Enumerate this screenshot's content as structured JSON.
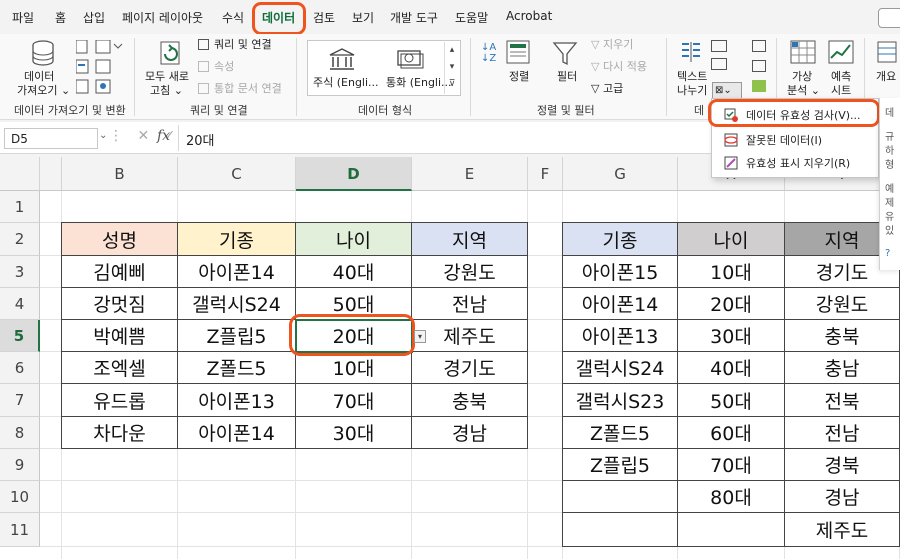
{
  "menu": {
    "tabs": [
      "파일",
      "홈",
      "삽입",
      "페이지 레이아웃",
      "수식",
      "데이터",
      "검토",
      "보기",
      "개발 도구",
      "도움말",
      "Acrobat"
    ],
    "active": "데이터"
  },
  "ribbon": {
    "get_data": {
      "label": "데이터 가져오기",
      "group": "데이터 가져오기 및 변환"
    },
    "queries": {
      "refresh_all": "모두 새로 고침",
      "queries_connections": "쿼리 및 연결",
      "properties": "속성",
      "edit_links": "통합 문서 연결",
      "group": "쿼리 및 연결"
    },
    "data_types": {
      "stocks": "주식 (Engli...",
      "currencies": "통화 (Engli...",
      "group": "데이터 형식"
    },
    "sort_filter": {
      "sort": "정렬",
      "filter": "필터",
      "clear": "지우기",
      "reapply": "다시 적용",
      "advanced": "고급",
      "group": "정렬 및 필터"
    },
    "data_tools": {
      "text_to_columns": "텍스트 나누기",
      "group_prefix": "데"
    },
    "forecast": {
      "what_if": "가상 분석",
      "forecast_sheet": "예측 시트",
      "outline": "개요"
    }
  },
  "dropdown": {
    "items": [
      "데이터 유효성 검사(V)...",
      "잘못된 데이터(I)",
      "유효성 표시 지우기(R)"
    ]
  },
  "side_panel": {
    "chars": [
      "데",
      "규",
      "하",
      "형",
      "예",
      "제",
      "유",
      "있",
      "?"
    ]
  },
  "formula_bar": {
    "name_box": "D5",
    "fx": "fx",
    "value": "20대"
  },
  "columns": [
    "B",
    "C",
    "D",
    "E",
    "F",
    "G",
    "H",
    "I"
  ],
  "rows": [
    "1",
    "2",
    "3",
    "4",
    "5",
    "6",
    "7",
    "8",
    "9",
    "10",
    "11"
  ],
  "selected": {
    "col": "D",
    "row": "5"
  },
  "table1": {
    "headers": [
      "성명",
      "기종",
      "나이",
      "지역"
    ],
    "header_colors": [
      "#fbe2d5",
      "#fff2cc",
      "#e2efda",
      "#d9e1f2"
    ],
    "rows": [
      [
        "김예삐",
        "아이폰14",
        "40대",
        "강원도"
      ],
      [
        "강멋짐",
        "갤럭시S24",
        "50대",
        "전남"
      ],
      [
        "박예쁨",
        "Z플립5",
        "20대",
        "제주도"
      ],
      [
        "조엑셀",
        "Z폴드5",
        "10대",
        "경기도"
      ],
      [
        "유드롭",
        "아이폰13",
        "70대",
        "충북"
      ],
      [
        "차다운",
        "아이폰14",
        "30대",
        "경남"
      ]
    ]
  },
  "table2": {
    "headers": [
      "기종",
      "나이",
      "지역"
    ],
    "header_colors": [
      "#d9e1f2",
      "#d0cece",
      "#a6a6a6"
    ],
    "col1": [
      "아이폰15",
      "아이폰14",
      "아이폰13",
      "갤럭시S24",
      "갤럭시S23",
      "Z폴드5",
      "Z플립5",
      "",
      ""
    ],
    "col2": [
      "10대",
      "20대",
      "30대",
      "40대",
      "50대",
      "60대",
      "70대",
      "80대",
      ""
    ],
    "col3": [
      "경기도",
      "강원도",
      "충북",
      "충남",
      "전북",
      "전남",
      "경북",
      "경남",
      "제주도"
    ]
  }
}
